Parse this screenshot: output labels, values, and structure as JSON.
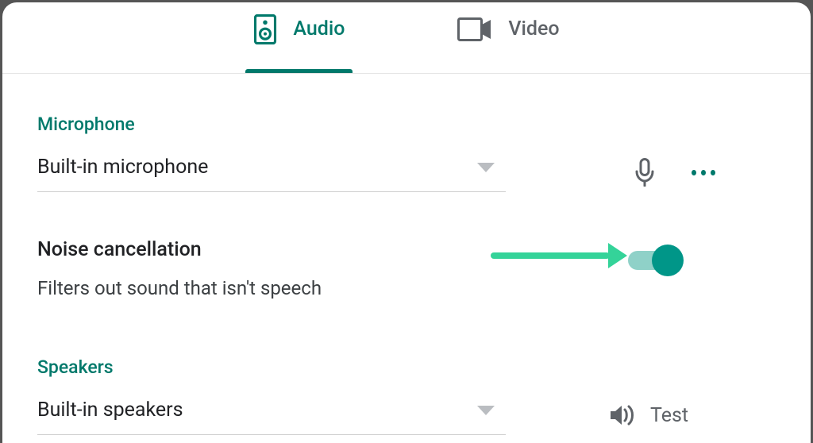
{
  "tabs": {
    "audio": "Audio",
    "video": "Video"
  },
  "microphone": {
    "section_label": "Microphone",
    "selected": "Built-in microphone"
  },
  "noise": {
    "title": "Noise cancellation",
    "subtitle": "Filters out sound that isn't speech",
    "enabled": true
  },
  "speakers": {
    "section_label": "Speakers",
    "selected": "Built-in speakers",
    "test_label": "Test"
  },
  "colors": {
    "accent": "#00796b",
    "arrow": "#34d399"
  }
}
